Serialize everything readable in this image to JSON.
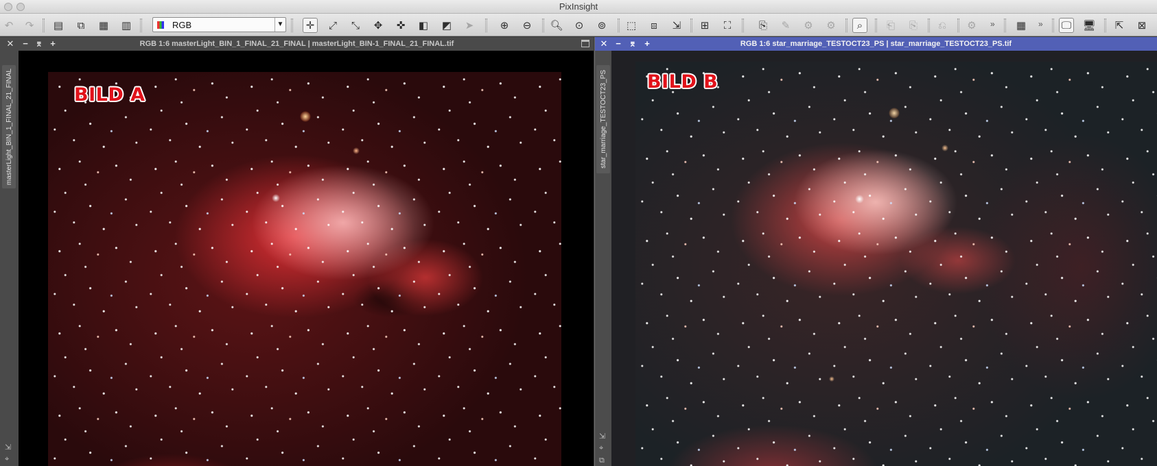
{
  "app": {
    "title": "PixInsight"
  },
  "toolbar": {
    "channel_select": {
      "value": "RGB",
      "icon": "rgb-swatch-icon"
    }
  },
  "windows": [
    {
      "title": "RGB 1:6 masterLight_BIN_1_FINAL_21_FINAL | masterLight_BIN-1_FINAL_21_FINAL.tif",
      "side_tab": "masterLight_BIN_1_FINAL_21_FINAL",
      "overlay_label": "BILD A",
      "active": false
    },
    {
      "title": "RGB 1:6 star_marriage_TESTOCT23_PS | star_marriage_TESTOCT23_PS.tif",
      "side_tab": "star_marriage_TESTOCT23_PS",
      "overlay_label": "BILD B",
      "active": true
    }
  ]
}
